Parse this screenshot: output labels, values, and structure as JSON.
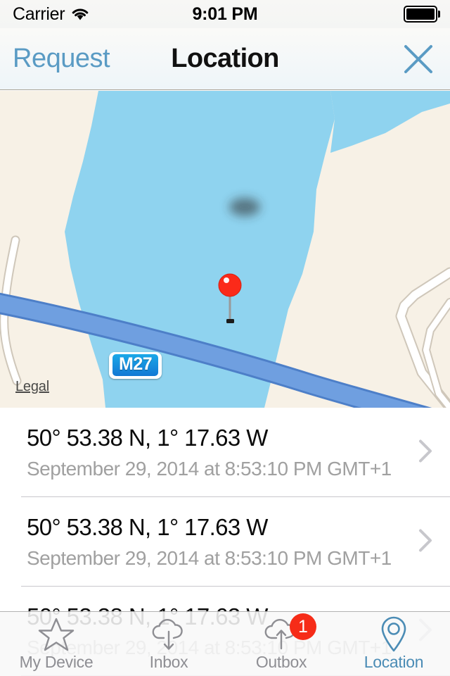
{
  "status_bar": {
    "carrier": "Carrier",
    "wifi_icon": "wifi-icon",
    "time": "9:01 PM",
    "battery_icon": "battery-full-icon"
  },
  "nav_bar": {
    "back_label": "Request",
    "title": "Location",
    "close_icon": "close-x-icon"
  },
  "map": {
    "legal_label": "Legal",
    "motorway_shield": "M27",
    "pin_icon": "map-pin-icon",
    "colors": {
      "land": "#f7f1e6",
      "water": "#8fd3ef",
      "motorway": "#6f9fe0",
      "motorway_edge": "#4d7fc8",
      "road": "#ffffff",
      "road_edge": "#cfc7ba",
      "pin": "#fb2a19"
    }
  },
  "list": {
    "rows": [
      {
        "title": "50° 53.38 N, 1° 17.63 W",
        "subtitle": "September 29, 2014 at 8:53:10 PM GMT+1",
        "chevron_icon": "chevron-right-icon"
      },
      {
        "title": "50° 53.38 N, 1° 17.63 W",
        "subtitle": "September 29, 2014 at 8:53:10 PM GMT+1",
        "chevron_icon": "chevron-right-icon"
      },
      {
        "title": "50° 53.38 N, 1° 17.63 W",
        "subtitle": "September 29, 2014 at 8:53:10 PM GMT+1",
        "chevron_icon": "chevron-right-icon"
      }
    ]
  },
  "tab_bar": {
    "active_color": "#4b8cb5",
    "inactive_color": "#8e8e93",
    "badge_color": "#f62c18",
    "tabs": [
      {
        "label": "My Device",
        "icon": "star-icon",
        "active": false,
        "badge": ""
      },
      {
        "label": "Inbox",
        "icon": "cloud-download-icon",
        "active": false,
        "badge": ""
      },
      {
        "label": "Outbox",
        "icon": "cloud-upload-icon",
        "active": false,
        "badge": "1"
      },
      {
        "label": "Location",
        "icon": "map-pin-icon",
        "active": true,
        "badge": ""
      }
    ]
  }
}
